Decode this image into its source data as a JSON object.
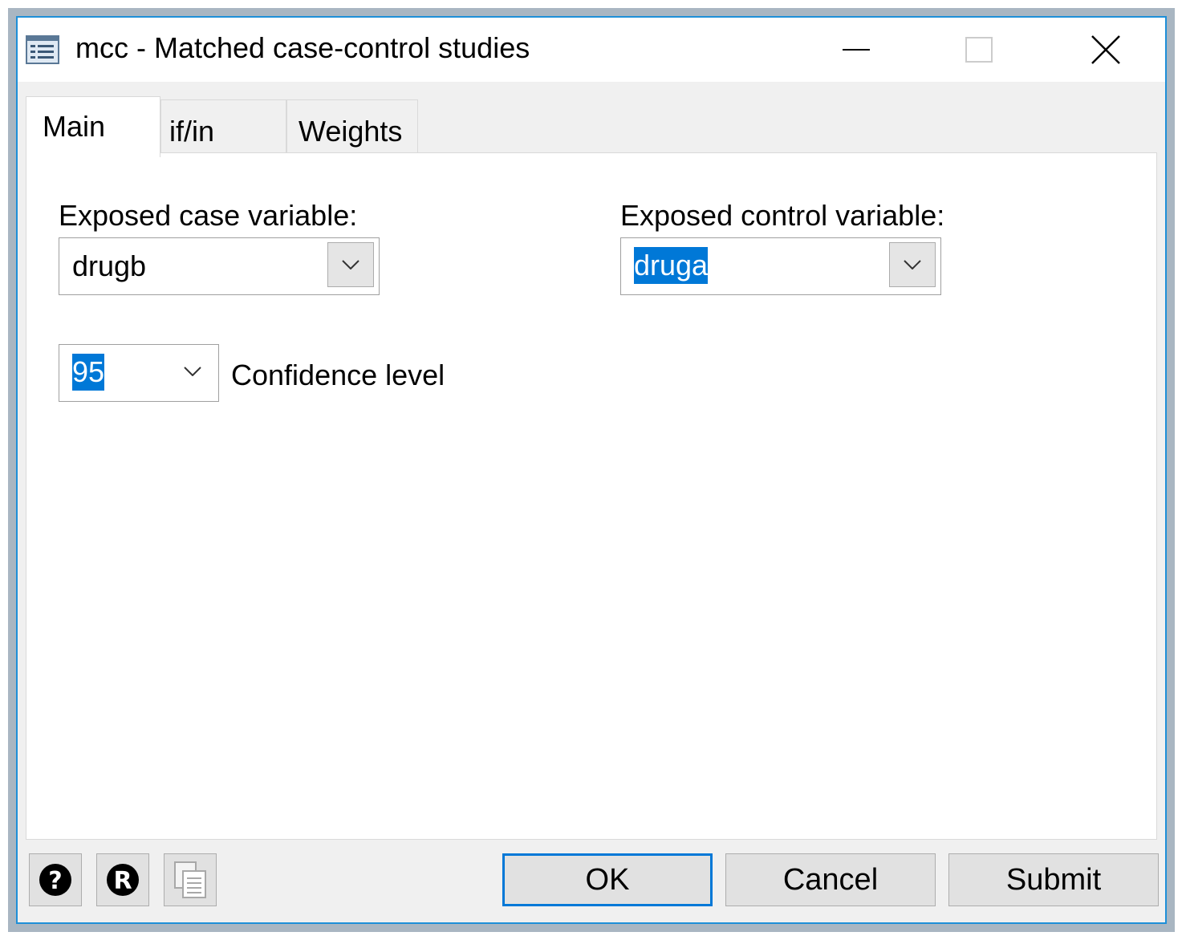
{
  "window": {
    "title": "mcc - Matched case-control studies",
    "accent_color": "#0078d7",
    "icons": {
      "app": "dialog-list-icon",
      "minimize": "minimize-icon",
      "maximize": "maximize-icon",
      "close": "close-icon"
    }
  },
  "tabs": [
    {
      "label": "Main",
      "active": true
    },
    {
      "label": "if/in",
      "active": false
    },
    {
      "label": "Weights",
      "active": false
    }
  ],
  "main": {
    "case_label": "Exposed case variable:",
    "case_value": "drugb",
    "control_label": "Exposed control variable:",
    "control_value": "druga",
    "confidence_value": "95",
    "confidence_label": "Confidence level"
  },
  "footer": {
    "help_icon": "help-icon",
    "reset_icon": "reset-icon",
    "copy_icon": "copy-command-icon",
    "ok_label": "OK",
    "cancel_label": "Cancel",
    "submit_label": "Submit"
  }
}
